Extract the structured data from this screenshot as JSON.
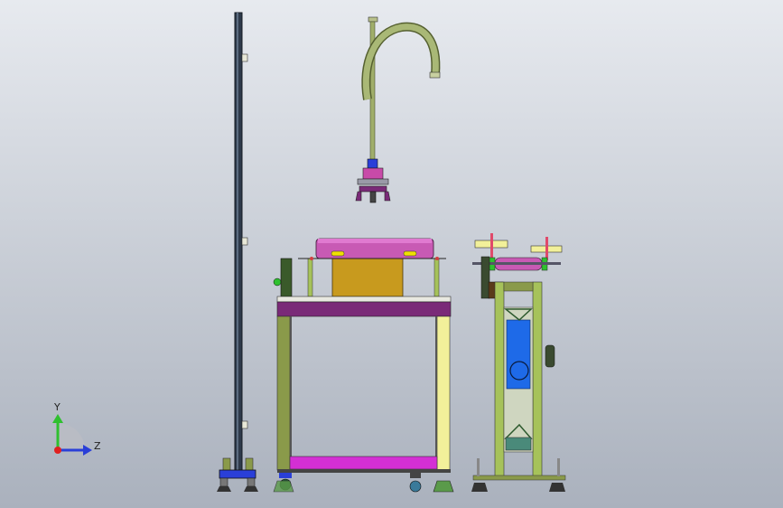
{
  "viewport": {
    "background_top": "#e7eaef",
    "background_bottom": "#aab1bd"
  },
  "triad": {
    "y_label": "Y",
    "z_label": "Z",
    "y_color": "#2fc02f",
    "z_color": "#2a3fd8",
    "x_color": "#e02020"
  },
  "colors": {
    "frame_olive": "#8a9a4a",
    "frame_green": "#a6c25a",
    "panel_yellow": "#f2f09a",
    "panel_purple": "#7a2a78",
    "panel_magenta": "#d42fd4",
    "box_orange": "#c89a1e",
    "cover_pink": "#c85ab4",
    "screen_blue": "#1e6ae8",
    "pole_dark": "#2e3a4a"
  },
  "parts": [
    "left-pole",
    "hanging-gripper",
    "workbench",
    "feeder-station"
  ]
}
